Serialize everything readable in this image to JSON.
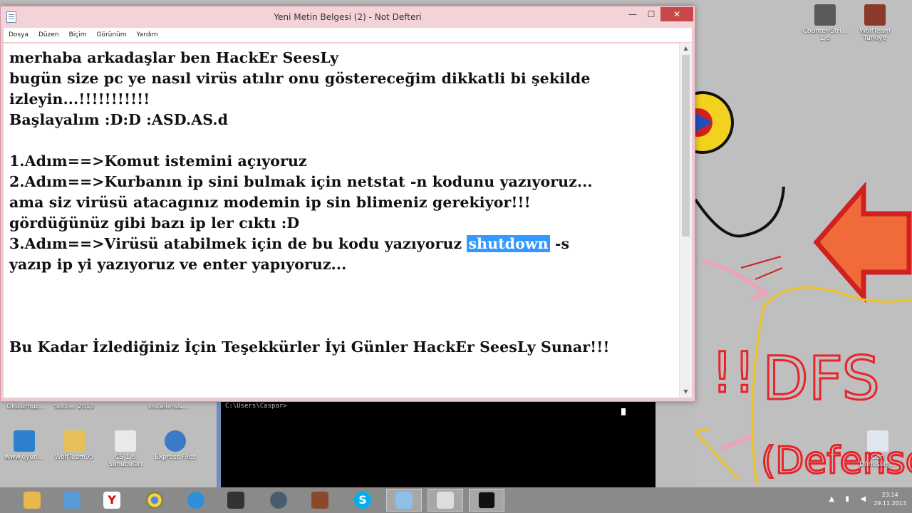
{
  "window": {
    "title": "Yeni Metin Belgesi (2) - Not Defteri",
    "controls": {
      "minimize": "—",
      "maximize": "☐",
      "close": "✕"
    }
  },
  "menu": [
    "Dosya",
    "Düzen",
    "Biçim",
    "Görünüm",
    "Yardım"
  ],
  "document": {
    "lines": [
      "merhaba arkadaşlar ben HackEr SeesLy",
      "bugün size pc ye nasıl virüs atılır onu göstereceğim dikkatli bi şekilde",
      "izleyin...!!!!!!!!!!!",
      "Başlayalım :D:D :ASD.AS.d",
      "",
      "1.Adım==>Komut istemini açıyoruz",
      "2.Adım==>Kurbanın ip sini bulmak için netstat -n kodunu yazıyoruz...",
      "ama siz virüsü atacagınız modemin ip sin blimeniz gerekiyor!!!",
      "gördüğünüz gibi bazı ip ler cıktı :D"
    ],
    "line_step3_before": "3.Adım==>Virüsü atabilmek için de bu kodu yazıyoruz",
    "line_step3_selected": "shutdown",
    "line_step3_after": " -s",
    "line_step3_cont": "yazıp ip yi yazıyoruz ve enter yapıyoruz...",
    "closing_line": "Bu Kadar İzlediğiniz İçin Teşekkürler İyi Günler HackEr SeesLy Sunar!!!"
  },
  "console": {
    "prompt": "C:\\Users\\Caspar>"
  },
  "desktop_icons": {
    "top_right": [
      {
        "label": "Counter-Stri... 1.6",
        "icon": "game-shortcut-icon"
      },
      {
        "label": "WolfTeam Türkiye",
        "icon": "game-shortcut-icon"
      }
    ],
    "bottom_left_row1": [
      "Okulumuz...",
      "Soccer 2013",
      "",
      "Installers&..."
    ],
    "bottom_left_row2": [
      "www.oyun...",
      "WolfTeam95",
      "CS 1.6 Sunucuları",
      "Express Files"
    ],
    "recycle_bin": "Geri Dönüşüm..."
  },
  "paint": {
    "text_dfs": "DFS",
    "text_defense": "(Defense)",
    "text_exclaim": "!!",
    "colors": {
      "red": "#e8232a",
      "orange": "#f06a3a",
      "yellow": "#f2c31e",
      "pink": "#f2a0b6",
      "black": "#111111"
    }
  },
  "taskbar": {
    "apps": [
      {
        "name": "file-explorer-icon",
        "color": "#e8b84a"
      },
      {
        "name": "network-icon",
        "color": "#5a9ad6"
      },
      {
        "name": "yandex-icon",
        "color": "#ffffff"
      },
      {
        "name": "chrome-icon",
        "color": "#4caf50"
      },
      {
        "name": "media-icon",
        "color": "#2f8fd8"
      },
      {
        "name": "game-icon",
        "color": "#333333"
      },
      {
        "name": "steam-icon",
        "color": "#4a5d70"
      },
      {
        "name": "game2-icon",
        "color": "#8a4a2a"
      },
      {
        "name": "skype-icon",
        "color": "#00aff0"
      },
      {
        "name": "notepad-icon",
        "color": "#8fbfe8"
      },
      {
        "name": "camera-icon",
        "color": "#dddddd"
      },
      {
        "name": "cmd-icon",
        "color": "#111111"
      }
    ],
    "time": "23:14",
    "date": "29.11.2013"
  }
}
